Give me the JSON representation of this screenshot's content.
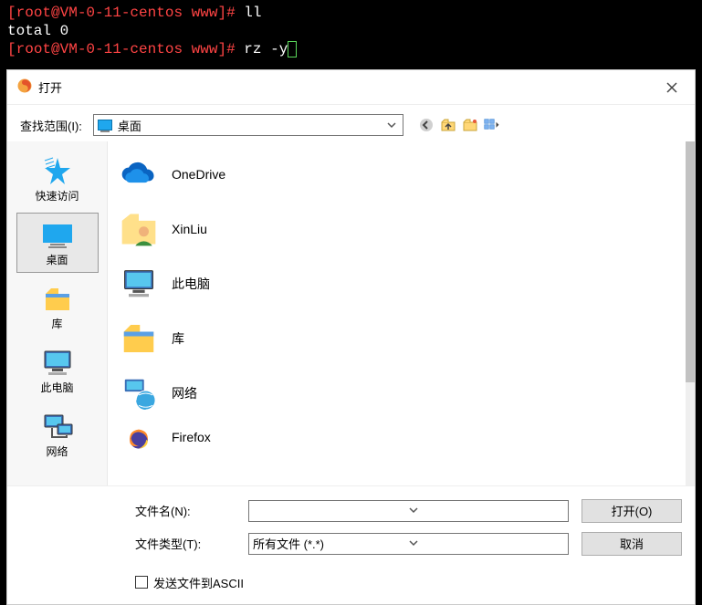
{
  "terminal": {
    "prompt_host": "root@VM-0-11-centos",
    "prompt_dir": "www",
    "line1_cmd": "ll",
    "line2": "total 0",
    "line3_cmd": "rz -y"
  },
  "dialog": {
    "title": "打开",
    "lookin_label": "查找范围(I):",
    "lookin_value": "桌面",
    "places": [
      {
        "id": "quick",
        "label": "快速访问"
      },
      {
        "id": "desktop",
        "label": "桌面"
      },
      {
        "id": "libs",
        "label": "库"
      },
      {
        "id": "pc",
        "label": "此电脑"
      },
      {
        "id": "network",
        "label": "网络"
      }
    ],
    "files": [
      {
        "id": "onedrive",
        "label": "OneDrive"
      },
      {
        "id": "xinliu",
        "label": "XinLiu"
      },
      {
        "id": "thispc",
        "label": "此电脑"
      },
      {
        "id": "libs",
        "label": "库"
      },
      {
        "id": "network",
        "label": "网络"
      },
      {
        "id": "firefox",
        "label": "Firefox"
      }
    ],
    "filename_label": "文件名(N):",
    "filetype_label": "文件类型(T):",
    "filetype_value": "所有文件 (*.*)",
    "open_btn": "打开(O)",
    "cancel_btn": "取消",
    "ascii_check_label": "发送文件到ASCII"
  }
}
